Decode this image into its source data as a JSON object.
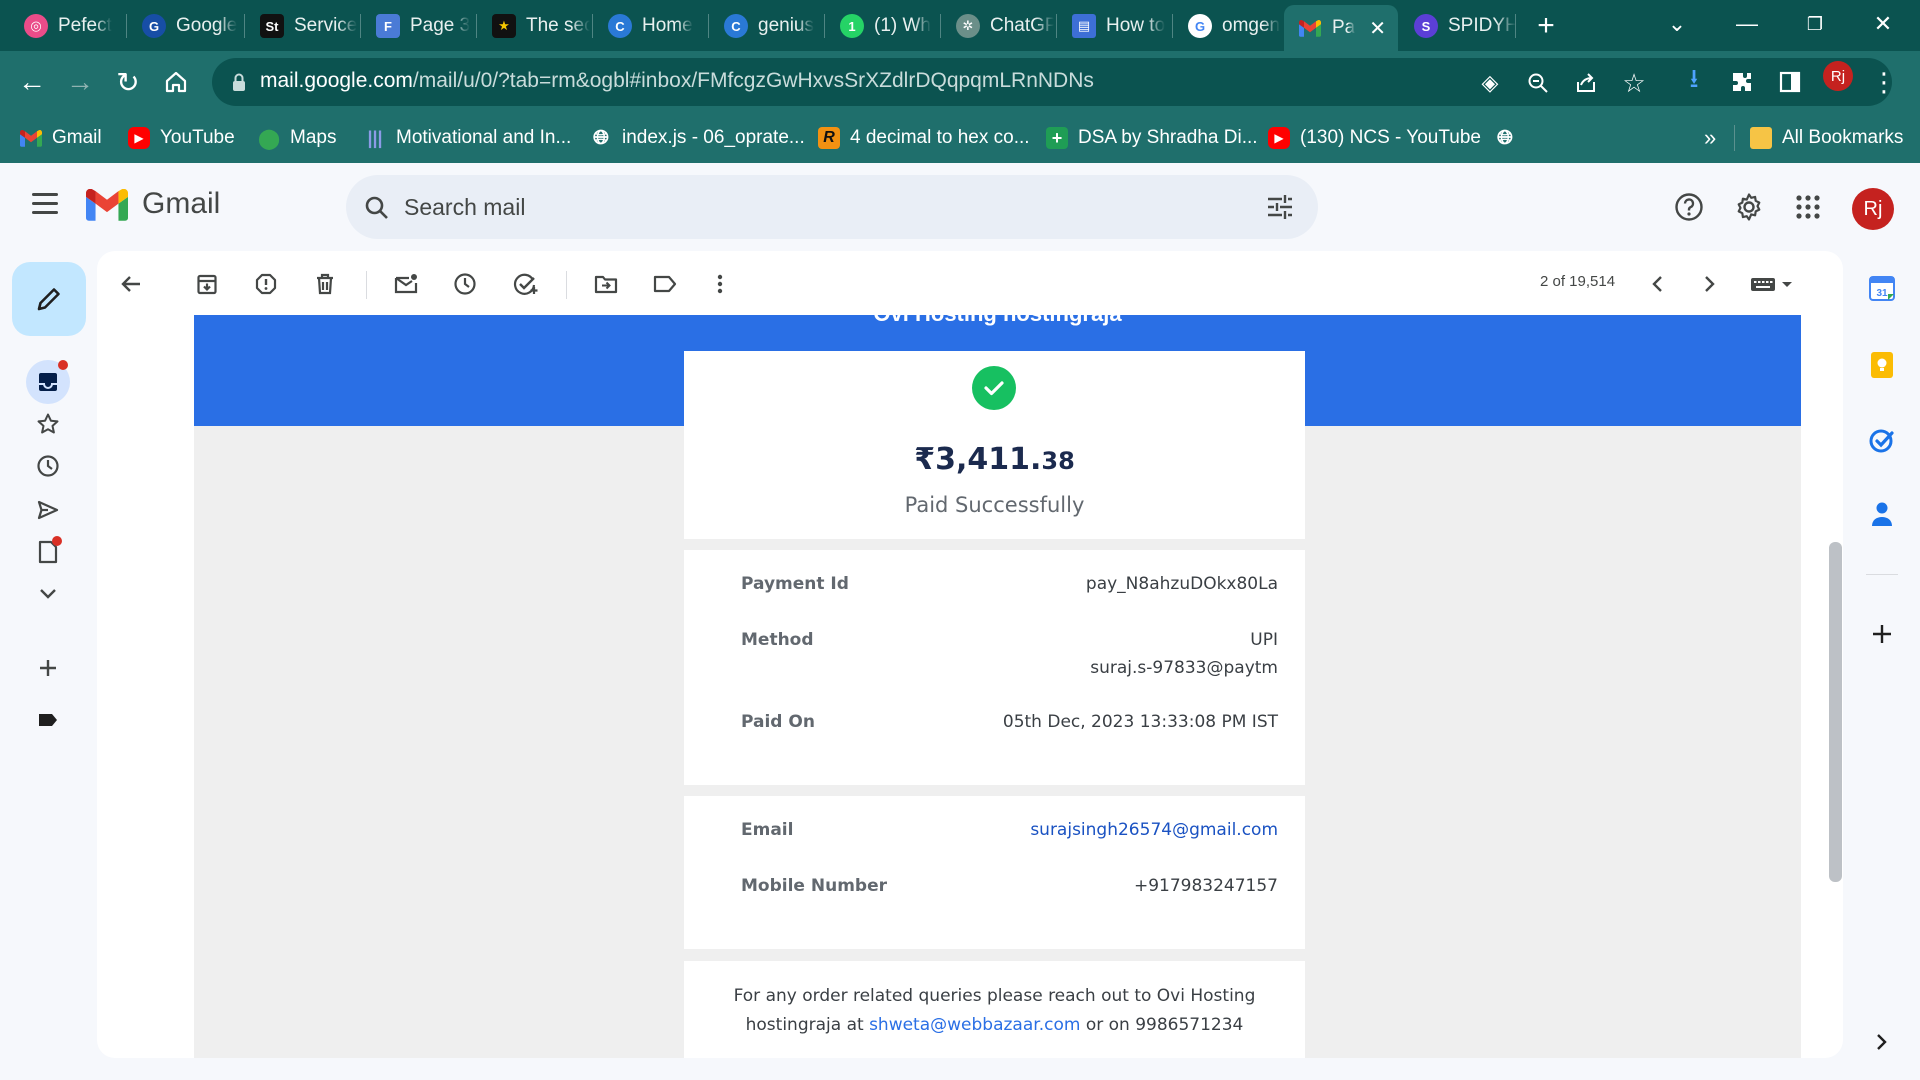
{
  "browser": {
    "tabs": [
      {
        "label": "Pefect",
        "favicon": "dribbble-icon",
        "color": "#ea4c89"
      },
      {
        "label": "Google",
        "favicon": "google-lens-icon",
        "color": "#4285f4"
      },
      {
        "label": "Service",
        "favicon": "st-icon",
        "color": "#111111"
      },
      {
        "label": "Page 3",
        "favicon": "forms-icon",
        "color": "#4a7bd6"
      },
      {
        "label": "The sec",
        "favicon": "star-icon",
        "color": "#111111"
      },
      {
        "label": "Home",
        "favicon": "canva-icon",
        "color": "#2a79d6"
      },
      {
        "label": "genius",
        "favicon": "canva-icon",
        "color": "#2a79d6"
      },
      {
        "label": "(1) Wh",
        "favicon": "whatsapp-icon",
        "color": "#25d366"
      },
      {
        "label": "ChatGP",
        "favicon": "chatgpt-icon",
        "color": "#6b8f89"
      },
      {
        "label": "How to",
        "favicon": "book-icon",
        "color": "#3d6fd6"
      },
      {
        "label": "omgen",
        "favicon": "google-icon",
        "color": "#ffffff"
      },
      {
        "label": "Pa",
        "favicon": "gmail-icon",
        "color": "#ffffff",
        "active": true
      },
      {
        "label": "SPIDYH",
        "favicon": "spidy-icon",
        "color": "#5b3fd6"
      }
    ],
    "new_tab": "+",
    "url_host": "mail.google.com",
    "url_path": "/mail/u/0/?tab=rm&ogbl#inbox/FMfcgzGwHxvsSrXZdlrDQqpqmLRnNDNs",
    "profile_initials": "Rj",
    "bookmarks": [
      {
        "label": "Gmail",
        "icon": "gmail-icon",
        "color": "#ea4335"
      },
      {
        "label": "YouTube",
        "icon": "youtube-icon",
        "color": "#ff0000"
      },
      {
        "label": "Maps",
        "icon": "maps-icon",
        "color": "#34a853"
      },
      {
        "label": "Motivational and In...",
        "icon": "soundwave-icon",
        "color": "#6b7bd6"
      },
      {
        "label": "index.js - 06_oprate...",
        "icon": "globe-icon",
        "color": "#ffffff"
      },
      {
        "label": "4 decimal to hex co...",
        "icon": "r-icon",
        "color": "#f29111"
      },
      {
        "label": "DSA by Shradha Di...",
        "icon": "plus-sheet-icon",
        "color": "#1f9d55"
      },
      {
        "label": "(130) NCS - YouTube",
        "icon": "youtube-icon",
        "color": "#ff0000"
      }
    ],
    "more_bookmarks": "»",
    "all_bookmarks": "All Bookmarks"
  },
  "gmail": {
    "logo_text": "Gmail",
    "search_placeholder": "Search mail",
    "avatar_initials": "Rj",
    "pager_text": "2 of 19,514"
  },
  "email": {
    "merchant_title": "Ovi Hosting hostingraja",
    "amount_main": "₹3,411.",
    "amount_decimal": "38",
    "status": "Paid Successfully",
    "details": [
      {
        "label": "Payment Id",
        "value": "pay_N8ahzuDOkx80La"
      },
      {
        "label": "Method",
        "value": "UPI",
        "value2": "suraj.s-97833@paytm"
      },
      {
        "label": "Paid On",
        "value": "05th Dec, 2023 13:33:08 PM IST"
      }
    ],
    "contact": [
      {
        "label": "Email",
        "value": "surajsingh26574@gmail.com"
      },
      {
        "label": "Mobile Number",
        "value": "+917983247157"
      }
    ],
    "footer_line1": "For any order related queries please reach out to Ovi Hosting",
    "footer_pre": "hostingraja at",
    "footer_email": "shweta@webbazaar.com",
    "footer_mid": "or on",
    "footer_phone": "9986571234"
  },
  "colors": {
    "brand_blue": "#2a6fe5",
    "success_green": "#17c061",
    "chrome_teal": "#1f6f6c"
  }
}
